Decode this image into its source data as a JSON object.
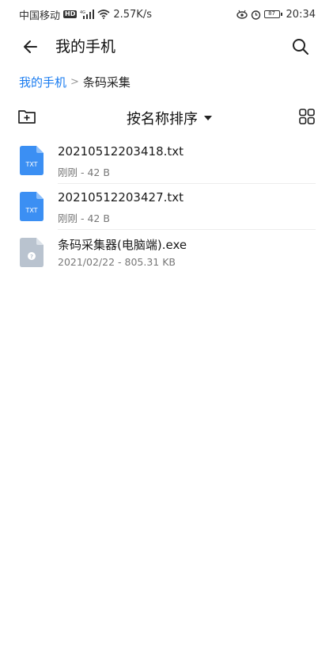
{
  "status_bar": {
    "carrier": "中国移动",
    "hd": "HD",
    "signal_prefix": "4G",
    "speed": "2.57K/s",
    "battery": "87",
    "time": "20:34"
  },
  "header": {
    "title": "我的手机"
  },
  "breadcrumb": {
    "root": "我的手机",
    "separator": ">",
    "current": "条码采集"
  },
  "toolbar": {
    "sort_label": "按名称排序"
  },
  "files": [
    {
      "name": "20210512203418.txt",
      "meta": "刚刚 - 42 B",
      "icon": "txt-file-icon",
      "badge": "TXT"
    },
    {
      "name": "20210512203427.txt",
      "meta": "刚刚 - 42 B",
      "icon": "txt-file-icon",
      "badge": "TXT"
    },
    {
      "name": "条码采集器(电脑端).exe",
      "meta": "2021/02/22 - 805.31 KB",
      "icon": "unknown-file-icon",
      "badge": "?"
    }
  ],
  "colors": {
    "accent": "#1a7cf0",
    "txt_icon": "#3b8ff3",
    "unknown_icon": "#b9c3cf"
  }
}
